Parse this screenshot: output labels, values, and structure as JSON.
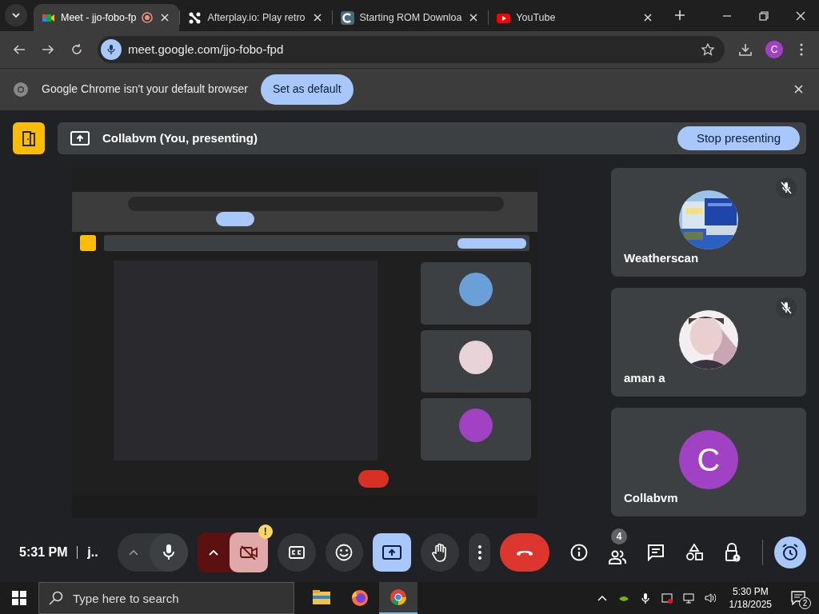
{
  "tabs": [
    {
      "kind": "meet",
      "title": "Meet - jjo-fobo-fp",
      "recording": true,
      "selected": true
    },
    {
      "kind": "afterplay",
      "title": "Afterplay.io: Play retro",
      "recording": false,
      "selected": false
    },
    {
      "kind": "rom",
      "title": "Starting ROM Downloa",
      "recording": false,
      "selected": false
    },
    {
      "kind": "youtube",
      "title": "YouTube",
      "recording": false,
      "selected": false
    }
  ],
  "address_bar": {
    "url": "meet.google.com/jjo-fobo-fpd",
    "profile_letter": "C"
  },
  "infobar": {
    "message": "Google Chrome isn't your default browser",
    "button": "Set as default"
  },
  "presenting_bar": {
    "label": "Collabvm (You, presenting)",
    "button": "Stop presenting"
  },
  "participants": [
    {
      "name": "Weatherscan",
      "kind": "screens",
      "muted": true
    },
    {
      "name": "aman a",
      "kind": "person",
      "muted": true
    },
    {
      "name": "Collabvm",
      "kind": "letter",
      "letter": "C",
      "muted": false
    }
  ],
  "call_bar": {
    "time": "5:31 PM",
    "meeting": "j..",
    "mic_on": true,
    "camera_on": false,
    "camera_warning": "!",
    "captions_on": false,
    "presenting": true,
    "hand_raised": false,
    "people_count": "4"
  },
  "taskbar": {
    "search_placeholder": "Type here to search",
    "apps": [
      {
        "kind": "files",
        "selected": false
      },
      {
        "kind": "firefox",
        "selected": false
      },
      {
        "kind": "chrome",
        "selected": true
      }
    ],
    "time": "5:30 PM",
    "date": "1/18/2025",
    "notifications": "2"
  }
}
